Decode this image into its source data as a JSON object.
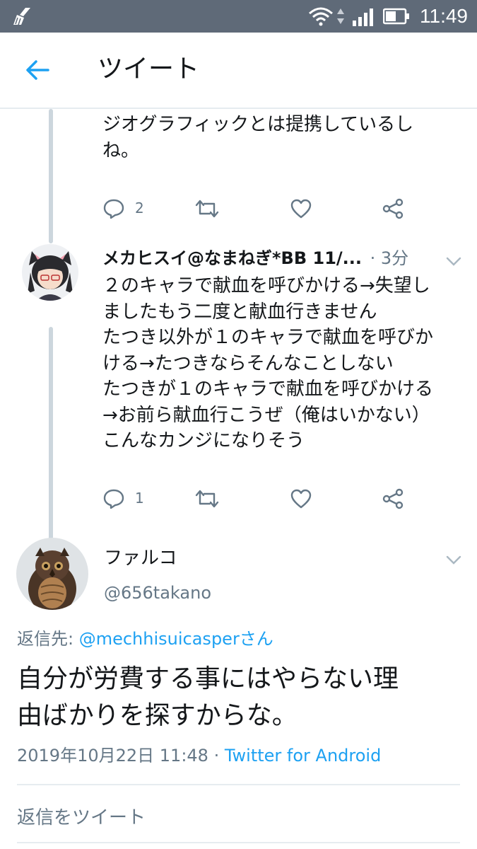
{
  "status_bar": {
    "time": "11:49",
    "icons": [
      "cleaner-broom-icon",
      "wifi-icon",
      "data-arrows-icon",
      "signal-icon",
      "battery-icon"
    ]
  },
  "header": {
    "back_icon": "arrow-left-icon",
    "title": "ツイート"
  },
  "colors": {
    "accent": "#1da1f2",
    "secondary_text": "#657786",
    "thread_line": "#ccd6dd",
    "status_bar": "#5f6a78"
  },
  "thread": {
    "previous_tweet": {
      "text_lines": [
        "ジオグラフィックとは提携しているし",
        "ね。"
      ],
      "reply_count": "2"
    },
    "second_tweet": {
      "display_name": "メカヒスイ@なまねぎ*BB 11/...",
      "time": "· 3分",
      "text_lines": [
        "２のキャラで献血を呼びかける→失望し",
        "ましたもう二度と献血行きません",
        "たつき以外が１のキャラで献血を呼びか",
        "ける→たつきならそんなことしない",
        "たつきが１のキャラで献血を呼びかける",
        "→お前ら献血行こうぜ（俺はいかない）",
        "こんなカンジになりそう"
      ],
      "reply_count": "1"
    }
  },
  "focused_tweet": {
    "display_name": "ファルコ",
    "handle": "@656takano",
    "replying_label": "返信先: ",
    "replying_handle": "@mechhisuicasperさん",
    "text_lines": [
      "自分が労費する事にはやらない理",
      "由ばかりを探すからな。"
    ],
    "timestamp": "2019年10月22日 11:48 · ",
    "source": "Twitter for Android"
  },
  "reply_box": {
    "placeholder": "返信をツイート"
  }
}
